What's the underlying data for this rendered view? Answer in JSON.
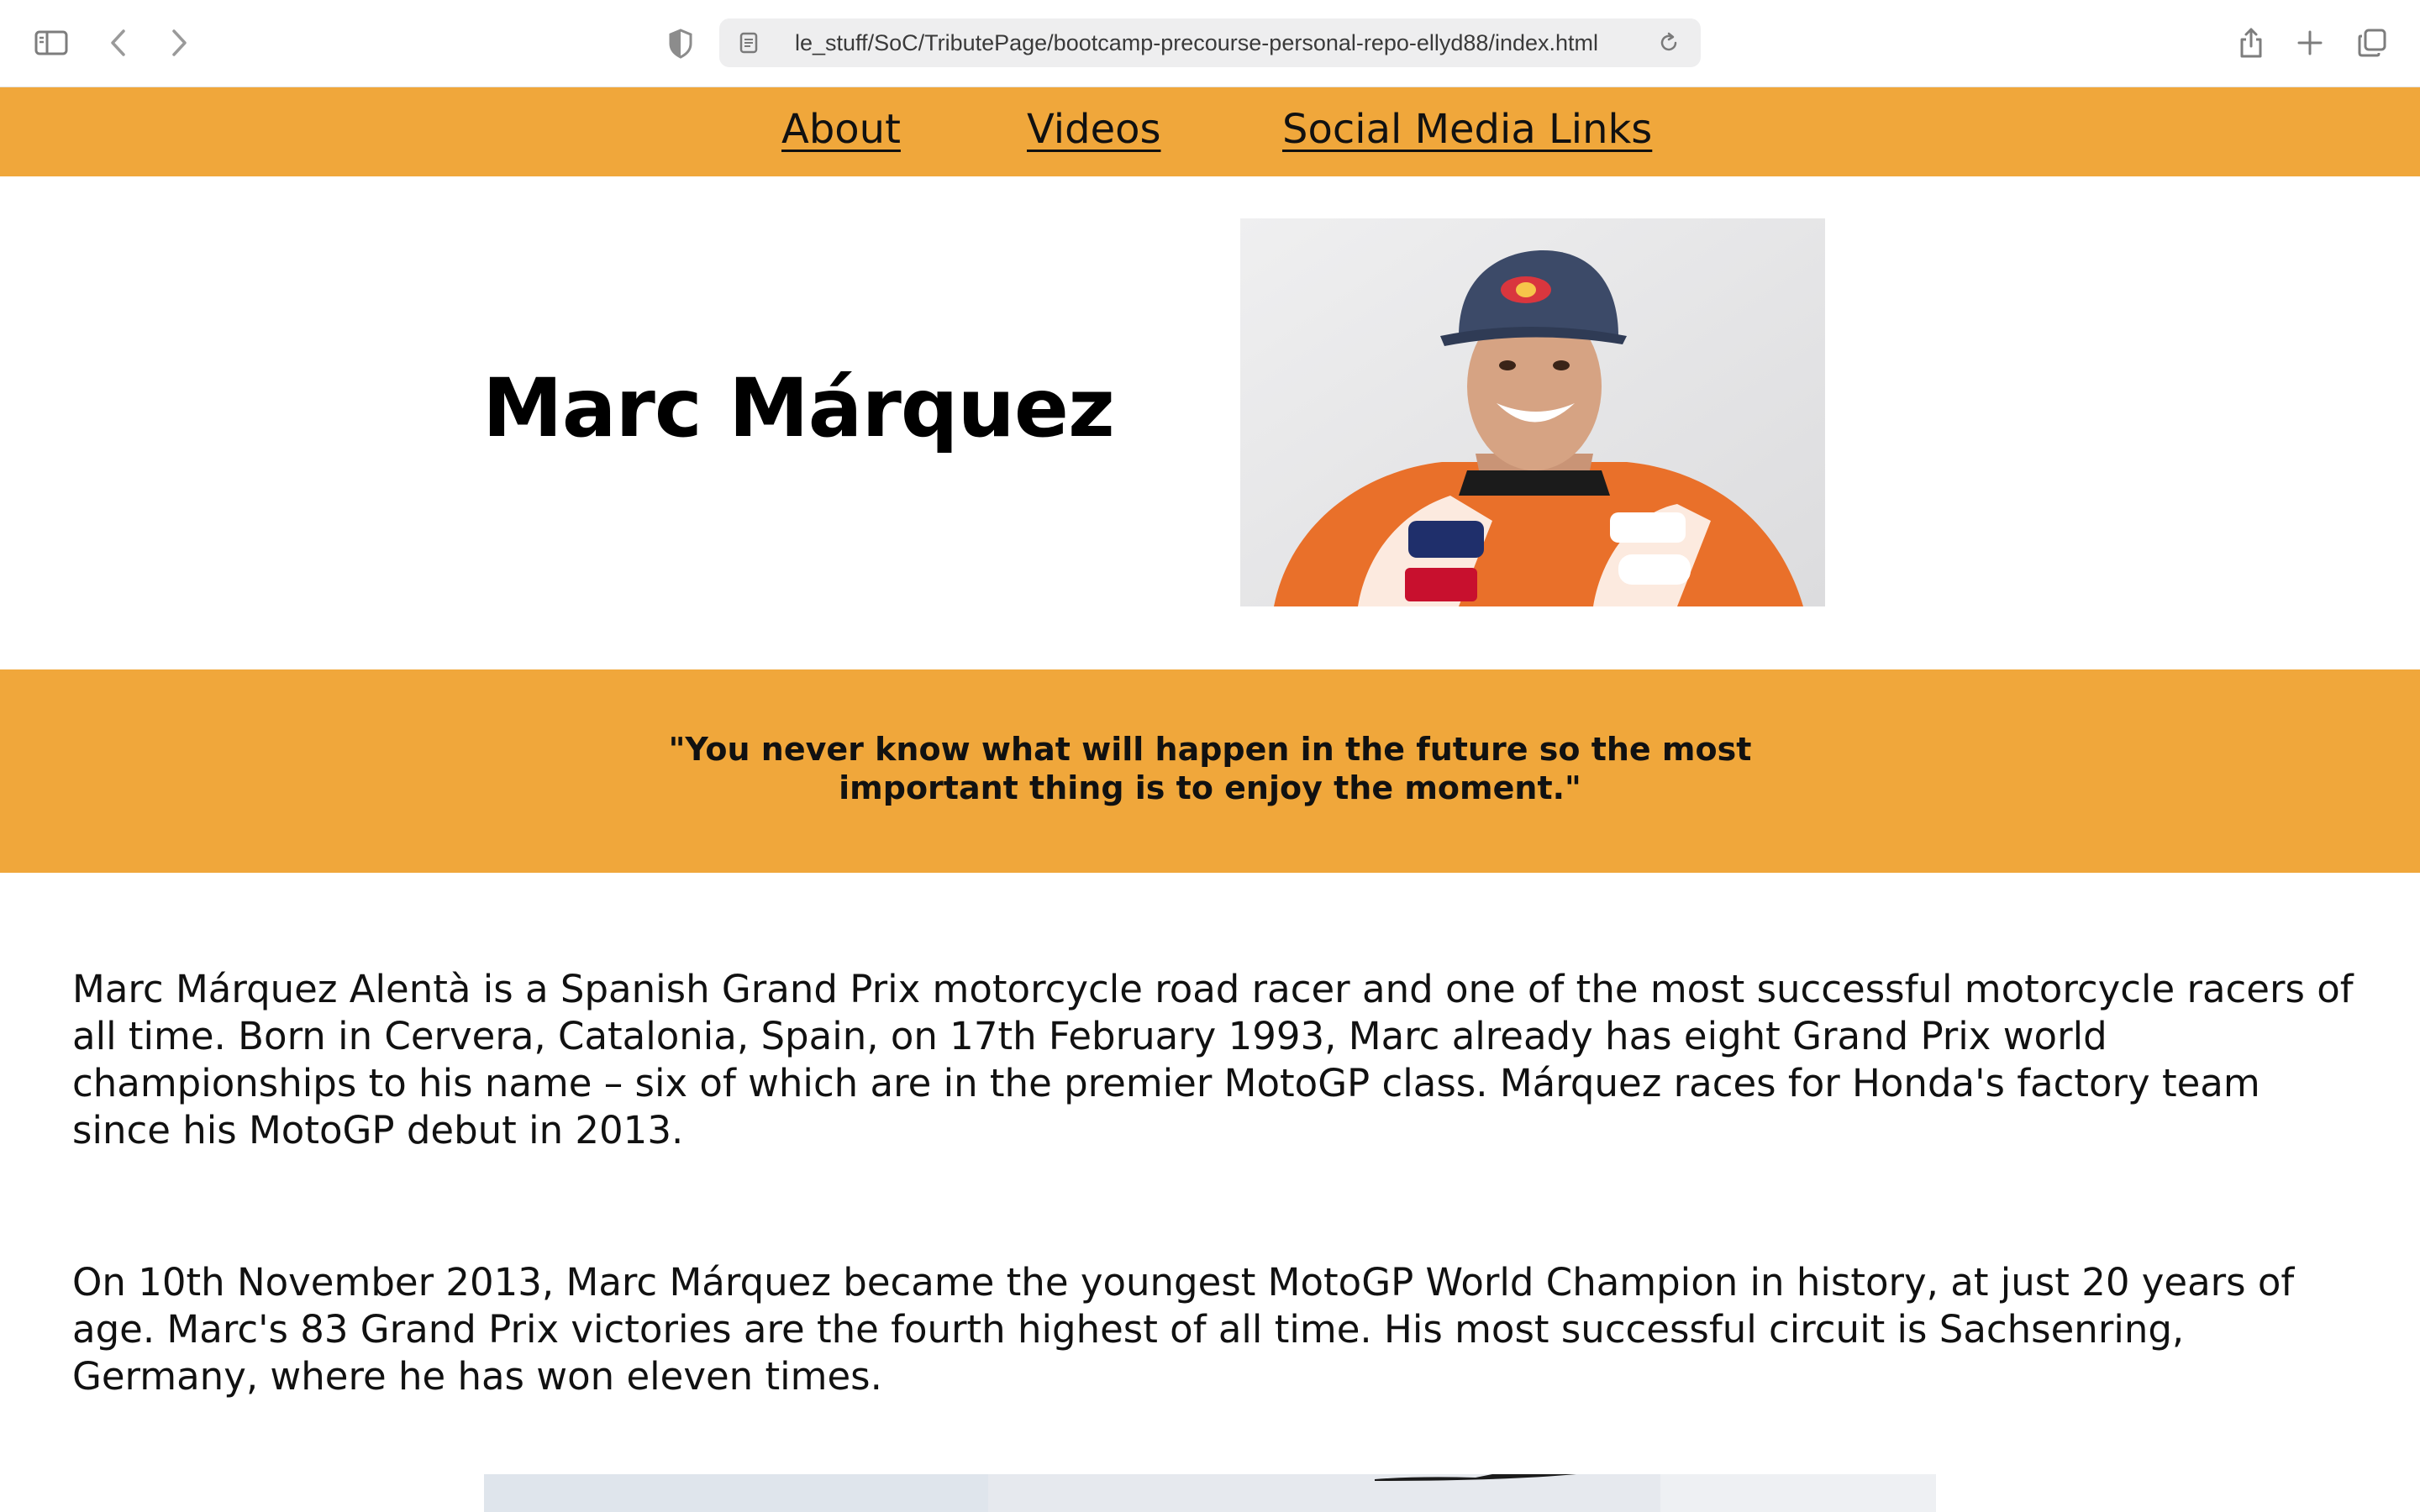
{
  "browser": {
    "url": "file:///Users/e_stuff/SoC/TributePage/bootcamp-precourse-personal-repo-ellyd88/index.html",
    "url_display": "le_stuff/SoC/TributePage/bootcamp-precourse-personal-repo-ellyd88/index.html",
    "icons": {
      "sidebar": "sidebar-icon",
      "back": "chevron-left-icon",
      "forward": "chevron-right-icon",
      "privacy": "shield-icon",
      "page": "page-icon",
      "reload": "reload-icon",
      "share": "share-icon",
      "new_tab": "plus-icon",
      "tab_overview": "tabs-icon"
    }
  },
  "nav": {
    "items": [
      {
        "label": "About"
      },
      {
        "label": "Videos"
      },
      {
        "label": "Social Media Links"
      }
    ]
  },
  "header": {
    "title": "Marc Márquez"
  },
  "quote": {
    "text": "\"You never know what will happen in the future so the most important thing is to enjoy the moment.\""
  },
  "bio": {
    "paragraphs": [
      "Marc Márquez Alentà is a Spanish Grand Prix motorcycle road racer and one of the most successful motorcycle racers of all time. Born in Cervera, Catalonia, Spain, on 17th February 1993, Marc already has eight Grand Prix world championships to his name – six of which are in the premier MotoGP class. Márquez races for Honda's factory team since his MotoGP debut in 2013.",
      "On 10th November 2013, Marc Márquez became the youngest MotoGP World Champion in history, at just 20 years of age. Marc's 83 Grand Prix victories are the fourth highest of all time. His most successful circuit is Sachsenring, Germany, where he has won eleven times."
    ]
  },
  "colors": {
    "accent": "#f0a73b",
    "text": "#111111",
    "background": "#ffffff"
  }
}
